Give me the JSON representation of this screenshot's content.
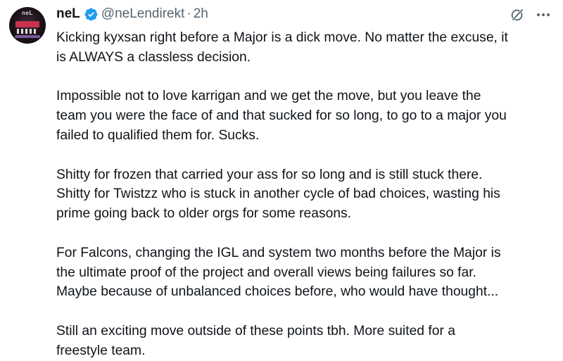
{
  "tweet": {
    "author": {
      "display_name": "neL",
      "handle": "@neLendirekt",
      "verified": true,
      "avatar_text": "neL"
    },
    "separator": "·",
    "time": "2h",
    "icons": {
      "verified": "verified-badge-icon",
      "grok": "grok-icon",
      "more": "more-options-icon"
    },
    "colors": {
      "verified_blue": "#1d9bf0",
      "secondary_text": "#536471",
      "primary_text": "#0f1419"
    },
    "paragraphs": [
      "Kicking kyxsan right before a Major is a dick move. No matter the excuse, it\nis ALWAYS a classless decision.",
      "Impossible not to love karrigan and we get the move, but you leave the\nteam you were the face of and that sucked for so long, to go to a major you\nfailed to qualified them for. Sucks.",
      "Shitty for frozen that carried your ass for so long and is still stuck there.\nShitty for Twistzz who is stuck in another cycle of bad choices, wasting his\nprime going back to older orgs for some reasons.",
      "For Falcons, changing the IGL and system two months before the Major is\nthe ultimate proof of the project and overall views being failures so far.\nMaybe because of unbalanced choices before, who would have thought...",
      "Still an exciting move outside of these points tbh. More suited for a\nfreestyle team."
    ]
  }
}
